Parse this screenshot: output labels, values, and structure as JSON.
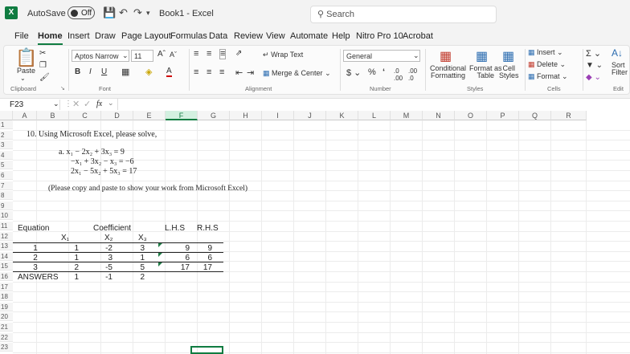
{
  "titlebar": {
    "autosave_label": "AutoSave",
    "autosave_state": "Off",
    "doc_title": "Book1 - Excel",
    "search_placeholder": "Search"
  },
  "tabs": [
    "File",
    "Home",
    "Insert",
    "Draw",
    "Page Layout",
    "Formulas",
    "Data",
    "Review",
    "View",
    "Automate",
    "Help",
    "Nitro Pro 10",
    "Acrobat"
  ],
  "ribbon": {
    "paste": "Paste",
    "clipboard": "Clipboard",
    "font_name": "Aptos Narrow",
    "font_size": "11",
    "font_group": "Font",
    "wrap_text": "Wrap Text",
    "merge_center": "Merge & Center",
    "alignment_group": "Alignment",
    "number_format": "General",
    "number_group": "Number",
    "conditional_formatting": [
      "Conditional",
      "Formatting"
    ],
    "format_as_table": [
      "Format as",
      "Table"
    ],
    "cell_styles": [
      "Cell",
      "Styles"
    ],
    "styles_group": "Styles",
    "insert": "Insert",
    "delete": "Delete",
    "format": "Format",
    "cells_group": "Cells",
    "sort_filter": [
      "Sort",
      "Filter"
    ],
    "editing_group": "Edit"
  },
  "formula_bar": {
    "name_box": "F23",
    "fx": "fx",
    "value": ""
  },
  "grid": {
    "columns": [
      "A",
      "B",
      "C",
      "D",
      "E",
      "F",
      "G",
      "H",
      "I",
      "J",
      "K",
      "L",
      "M",
      "N",
      "O",
      "P",
      "Q",
      "R"
    ],
    "selected_column": "F",
    "rows": [
      "1",
      "2",
      "3",
      "4",
      "5",
      "6",
      "7",
      "8",
      "9",
      "10",
      "11",
      "12",
      "13",
      "14",
      "15",
      "16",
      "17",
      "18",
      "19",
      "20",
      "21",
      "22",
      "23"
    ]
  },
  "content": {
    "question": "10. Using Microsoft Excel, please solve,",
    "eq_a": "a.  x₁ − 2x₂ + 3x₃ = 9",
    "eq_b": "−x₁ + 3x₂ − x₃ = −6",
    "eq_c": "2x₁ − 5x₂ + 5x₃ = 17",
    "instruction": "(Please copy and paste to show your work from Microsoft Excel)",
    "table": {
      "h_equation": "Equation",
      "h_coefficient": "Coefficient",
      "h_lhs": "L.H.S",
      "h_rhs": "R.H.S",
      "sub_x1": "X₁",
      "sub_x2": "X₂",
      "sub_x3": "X₃",
      "rows": [
        {
          "eq": "1",
          "x1": "1",
          "x2": "-2",
          "x3": "3",
          "lhs": "9",
          "rhs": "9"
        },
        {
          "eq": "2",
          "x1": "1",
          "x2": "3",
          "x3": "1",
          "lhs": "6",
          "rhs": "6"
        },
        {
          "eq": "3",
          "x1": "2",
          "x2": "-5",
          "x3": "5",
          "lhs": "17",
          "rhs": "17"
        }
      ],
      "answers_label": "ANSWERS",
      "answers": {
        "x1": "1",
        "x2": "-1",
        "x3": "2"
      }
    }
  }
}
